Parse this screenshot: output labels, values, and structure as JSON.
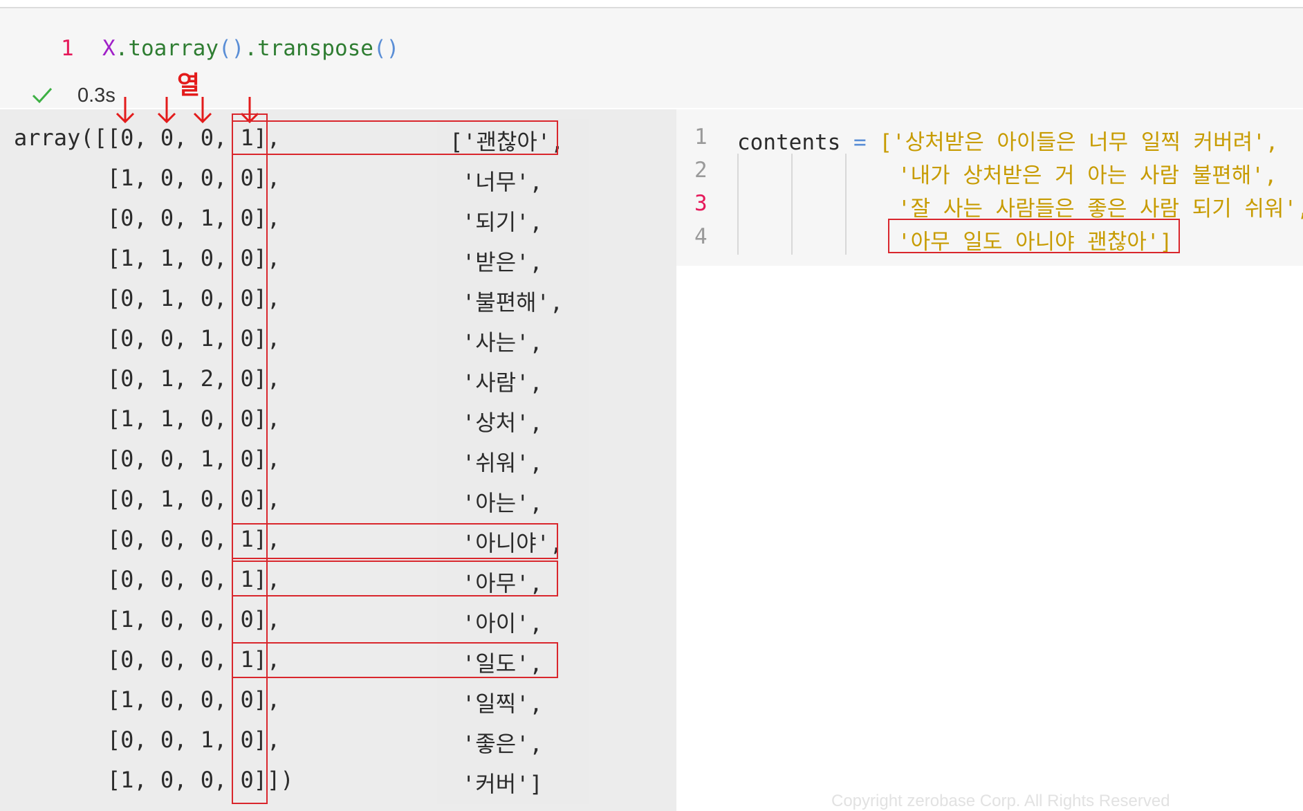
{
  "top_cell": {
    "line_number": "1",
    "code_object": "X",
    "code_method1": ".toarray",
    "code_parens1": "()",
    "code_method2": ".transpose",
    "code_parens2": "()",
    "exec_time": "0.3s"
  },
  "annotation": {
    "column_label": "열"
  },
  "output": {
    "rows": [
      "array([[0, 0, 0, 1],",
      "       [1, 0, 0, 0],",
      "       [0, 0, 1, 0],",
      "       [1, 1, 0, 0],",
      "       [0, 1, 0, 0],",
      "       [0, 0, 1, 0],",
      "       [0, 1, 2, 0],",
      "       [1, 1, 0, 0],",
      "       [0, 0, 1, 0],",
      "       [0, 1, 0, 0],",
      "       [0, 0, 0, 1],",
      "       [0, 0, 0, 1],",
      "       [1, 0, 0, 0],",
      "       [0, 0, 0, 1],",
      "       [1, 0, 0, 0],",
      "       [0, 0, 1, 0],",
      "       [1, 0, 0, 0]])"
    ],
    "vocab": [
      "['괜찮아',",
      "'너무',",
      "'되기',",
      "'받은',",
      "'불편해',",
      "'사는',",
      "'사람',",
      "'상처',",
      "'쉬워',",
      "'아는',",
      "'아니야',",
      "'아무',",
      "'아이',",
      "'일도',",
      "'일찍',",
      "'좋은',",
      "'커버']"
    ]
  },
  "right_cell": {
    "line_numbers": [
      "1",
      "2",
      "3",
      "4"
    ],
    "var_name": "contents",
    "op": "=",
    "lines": [
      "['상처받은 아이들은 너무 일찍 커버려',",
      "'내가 상처받은 거 아는 사람 불편해',",
      "'잘 사는 사람들은 좋은 사람 되기 쉬워',",
      "'아무 일도 아니야 괜찮아']"
    ]
  },
  "watermark": "Copyright zerobase Corp. All Rights Reserved",
  "colors": {
    "highlight_red": "#d9262c",
    "line_number_active": "#e5195a",
    "string_yellow": "#c79b00",
    "check_green": "#3cb043"
  }
}
